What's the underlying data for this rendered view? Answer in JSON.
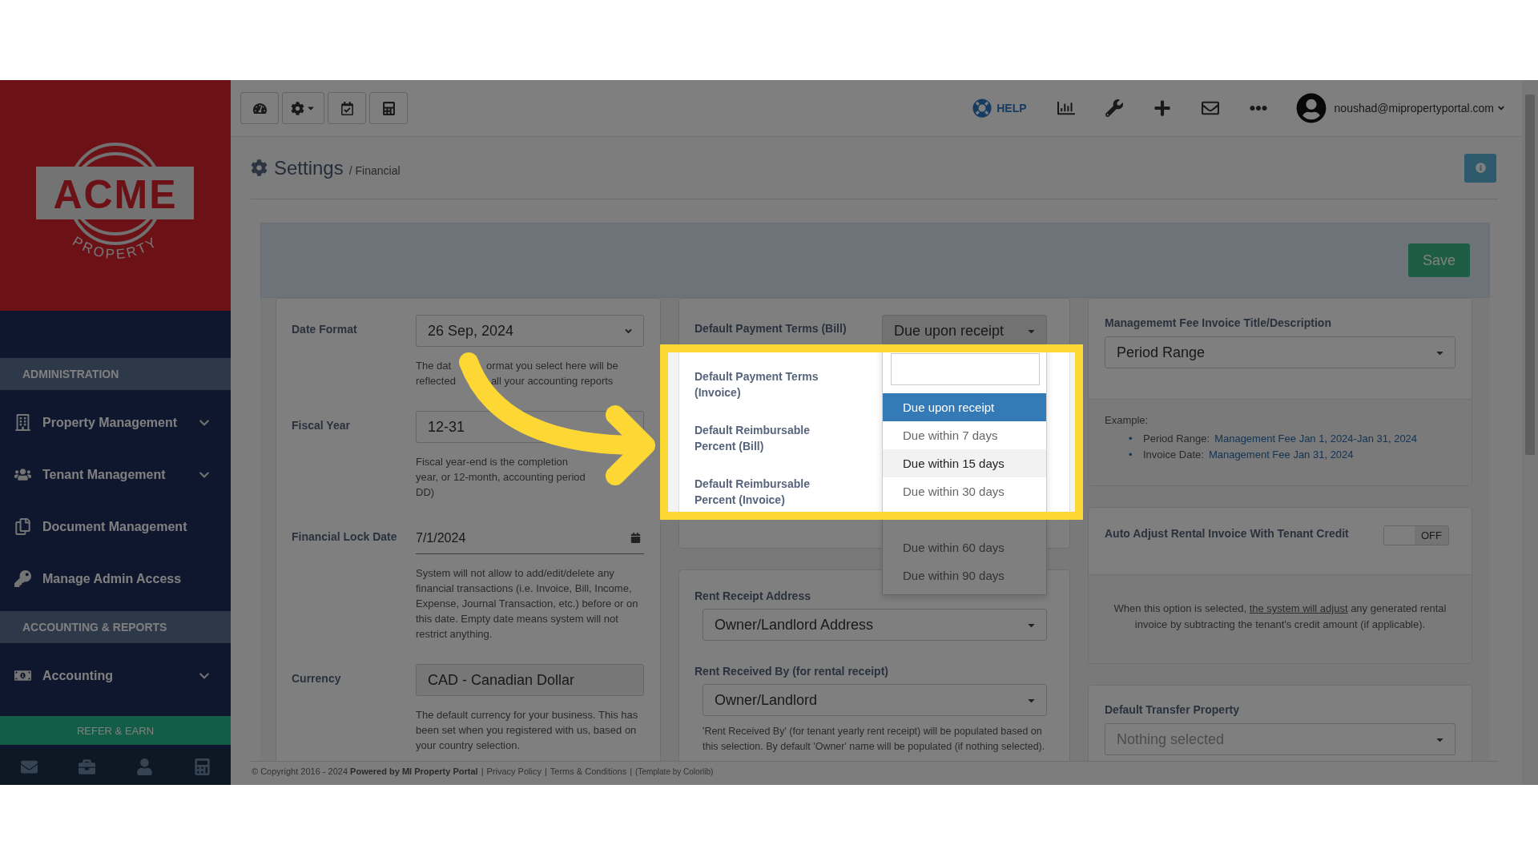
{
  "sidebar": {
    "logo": {
      "word": "ACME",
      "subword": "PROPERTY"
    },
    "sections": [
      {
        "title": "ADMINISTRATION",
        "items": [
          {
            "label": "Property Management",
            "expandable": true
          },
          {
            "label": "Tenant Management",
            "expandable": true
          },
          {
            "label": "Document Management",
            "expandable": false
          },
          {
            "label": "Manage Admin Access",
            "expandable": false
          }
        ]
      },
      {
        "title": "ACCOUNTING & REPORTS",
        "items": [
          {
            "label": "Accounting",
            "expandable": true
          }
        ]
      }
    ],
    "refer_button": "REFER & EARN"
  },
  "toolbar": {
    "left_buttons": [
      {
        "caret": false
      },
      {
        "caret": true
      },
      {
        "caret": false
      },
      {
        "caret": false
      }
    ],
    "help": "HELP",
    "user": "noushad@mipropertyportal.com"
  },
  "page": {
    "title": "Settings",
    "breadcrumb": "/ Financial"
  },
  "save_button": "Save",
  "general_card": {
    "fields": [
      {
        "label": "Date Format",
        "kind": "select",
        "value": "26 Sep, 2024",
        "help_lines": [
          [
            "The dat",
            "ormat you select here will be"
          ],
          [
            "reflected",
            "all your accounting reports"
          ]
        ]
      },
      {
        "label": "Fiscal Year",
        "kind": "text",
        "value": "12-31",
        "help_lines": [
          [
            "Fiscal year-end is the completion"
          ],
          [
            "year, or 12-month, accounting period"
          ],
          [
            "DD)"
          ]
        ]
      },
      {
        "label": "Financial Lock Date",
        "kind": "date",
        "value": "7/1/2024",
        "help": "System will not allow to add/edit/delete any financial transactions (i.e. Invoice, Bill, Income, Expense, Journal Transaction, etc.) before or on this date. Empty date means system will not restrict anything."
      },
      {
        "label": "Currency",
        "kind": "readonly",
        "value": "CAD - Canadian Dollar",
        "help": "The default currency for your business. This has been set when you registered with us, based on your country selection."
      }
    ]
  },
  "payment_card": {
    "rows": [
      {
        "label": "Default Payment Terms (Bill)",
        "value": "Due upon receipt",
        "open": true
      },
      {
        "label": "Default Payment Terms (Invoice)"
      },
      {
        "label": "Default Reimbursable Percent (Bill)"
      },
      {
        "label": "Default Reimbursable Percent (Invoice)"
      }
    ],
    "dropdown": {
      "options_visible": [
        {
          "label": "Due upon receipt",
          "selected": true,
          "hovered": false
        },
        {
          "label": "Due within 7 days",
          "selected": false,
          "hovered": false
        },
        {
          "label": "Due within 15 days",
          "selected": false,
          "hovered": true
        },
        {
          "label": "Due within 30 days",
          "selected": false,
          "hovered": false
        }
      ],
      "options_below": [
        {
          "label": "Due within 60 days",
          "selected": false,
          "hovered": false
        },
        {
          "label": "Due within 90 days",
          "selected": false,
          "hovered": false
        }
      ]
    }
  },
  "receipt_card": {
    "fields": [
      {
        "label": "Rent Receipt Address",
        "value": "Owner/Landlord Address"
      },
      {
        "label": "Rent Received By (for rental receipt)",
        "value": "Owner/Landlord",
        "help": "'Rent Received By' (for tenant yearly rent receipt) will be populated based on this selection. By default 'Owner' name will be populated (if nothing selected)."
      }
    ]
  },
  "fee_card": {
    "label": "Managememt Fee Invoice Title/Description",
    "value": "Period Range",
    "example_title": "Example:",
    "bullet": "•",
    "examples": [
      {
        "name": "Period Range:",
        "value": "Management Fee Jan 1, 2024-Jan 31, 2024"
      },
      {
        "name": "Invoice Date:",
        "value": "Management Fee Jan 31, 2024"
      }
    ]
  },
  "credit_card": {
    "label": "Auto Adjust Rental Invoice With Tenant Credit",
    "toggle": {
      "on": false,
      "text": "OFF"
    },
    "note": {
      "before": "When this option is selected,",
      "link": "the system will adjust",
      "after": "any generated rental invoice by subtracting the tenant's credit amount (if applicable)."
    }
  },
  "transfer_card": {
    "label": "Default Transfer Property",
    "placeholder": "Nothing selected"
  },
  "footer": {
    "text": "© Copyright 2016 - 2024 **Powered by MI Property Portal**",
    "separator": "|",
    "links": [
      "Privacy Policy",
      "Terms & Conditions"
    ],
    "credit": "(Template by Colorlib)"
  }
}
